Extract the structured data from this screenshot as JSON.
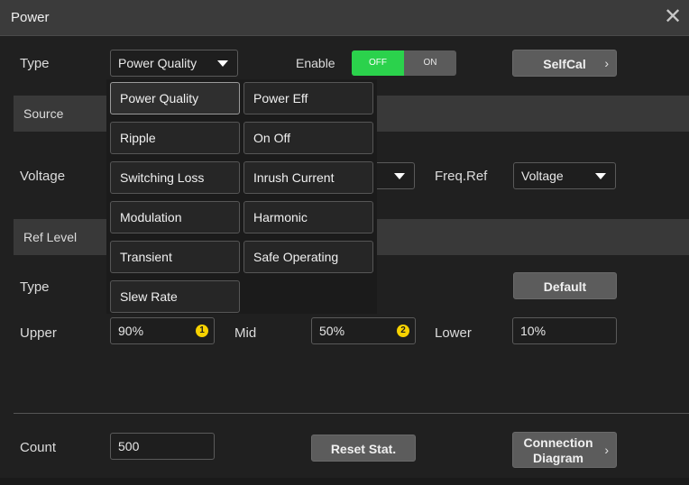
{
  "window": {
    "title": "Power",
    "close_glyph": "✕"
  },
  "type_row": {
    "label": "Type",
    "selected": "Power Quality",
    "enable_label": "Enable",
    "toggle_off": "OFF",
    "toggle_on": "ON",
    "toggle_state": "OFF",
    "selfcal_label": "SelfCal"
  },
  "source_section": {
    "label": "Source"
  },
  "voltage_row": {
    "label": "Voltage",
    "freq_ref_label": "Freq.Ref",
    "freq_ref_value": "Voltage"
  },
  "ref_level_section": {
    "label": "Ref Level"
  },
  "ref_type_row": {
    "label": "Type",
    "default_label": "Default"
  },
  "levels": {
    "upper_label": "Upper",
    "upper_value": "90%",
    "upper_badge": "1",
    "mid_label": "Mid",
    "mid_value": "50%",
    "mid_badge": "2",
    "lower_label": "Lower",
    "lower_value": "10%"
  },
  "count_row": {
    "label": "Count",
    "value": "500",
    "reset_label": "Reset Stat.",
    "connection_line1": "Connection",
    "connection_line2": "Diagram"
  },
  "type_menu": {
    "options": [
      "Power Quality",
      "Power Eff",
      "Ripple",
      "On Off",
      "Switching Loss",
      "Inrush Current",
      "Modulation",
      "Harmonic",
      "Transient",
      "Safe Operating",
      "Slew Rate"
    ],
    "selected_index": 0
  },
  "colors": {
    "toggle_active": "#2bd24c",
    "badge": "#f7d200",
    "accent_selected_border": "#9a9a9a"
  },
  "icons": {
    "close": "close-icon",
    "dropdown": "caret-down-icon",
    "chevron": "chevron-right-icon"
  }
}
